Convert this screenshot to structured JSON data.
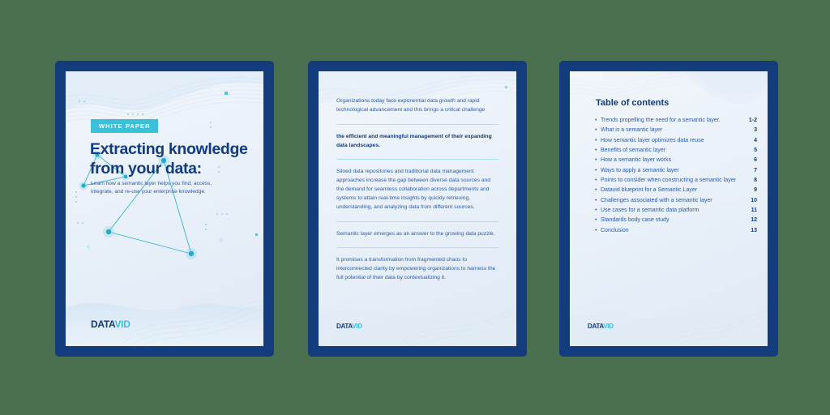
{
  "background_color": "#4a7050",
  "theme": {
    "frame_navy": "#123c7c",
    "accent_cyan": "#3cbfd9",
    "body_blue": "#2c5ba8",
    "paper": "#eaf1f9"
  },
  "brand": {
    "logo_part1": "DATA",
    "logo_part2": "VID"
  },
  "page1": {
    "badge": "WHITE PAPER",
    "title_line1": "Extracting knowledge",
    "title_line2": "from your data:",
    "subtitle": "Learn how a semantic layer helps you find, access, integrate, and re-use your enterprise knowledge."
  },
  "page2": {
    "paragraphs": [
      {
        "text": "Organizations today face exponential data growth and rapid technological advancement and this brings a critical challenge",
        "bold": false
      },
      {
        "text": "the efficient and meaningful management of their expanding data landscapes.",
        "bold": true
      },
      {
        "text": "Siloed data repositories and traditional data management approaches increase the gap between diverse data sources and the demand for seamless collaboration across departments and systems to attain real-time insights by quickly retrieving, understanding, and analyzing data from different sources.",
        "bold": false
      },
      {
        "text": "Semantic layer emerges as an answer to the growing data puzzle.",
        "bold": false
      },
      {
        "text": "It promises a transformation from fragmented chaos to interconnected clarity by empowering organizations to harness the full potential of their data by contextualizing it.",
        "bold": false
      }
    ]
  },
  "page3": {
    "heading": "Table of contents",
    "entries": [
      {
        "label": "Trends propelling the need for a semantic layer.",
        "page": "1-2"
      },
      {
        "label": "What is a semantic layer",
        "page": "3"
      },
      {
        "label": "How semantic layer optimizes data reuse",
        "page": "4"
      },
      {
        "label": "Benefits of semantic layer",
        "page": "5"
      },
      {
        "label": "How a semantic layer works",
        "page": "6"
      },
      {
        "label": "Ways to apply a semantic layer",
        "page": "7"
      },
      {
        "label": "Points to consider when constructing a semantic layer",
        "page": "8"
      },
      {
        "label": "Datavid blueprint for a Semantic Layer",
        "page": "9"
      },
      {
        "label": "Challenges associated with a semantic layer",
        "page": "10"
      },
      {
        "label": "Use cases for a semantic data platform",
        "page": "11"
      },
      {
        "label": "Standards body case study",
        "page": "12"
      },
      {
        "label": "Conclusion",
        "page": "13"
      }
    ]
  }
}
